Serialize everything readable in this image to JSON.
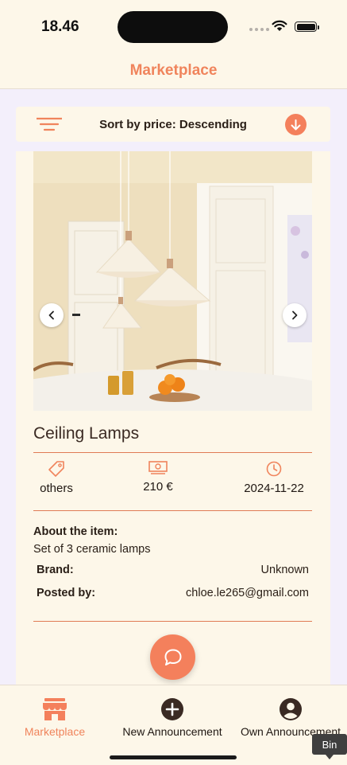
{
  "status_bar": {
    "time": "18.46"
  },
  "header": {
    "title": "Marketplace"
  },
  "sort": {
    "label": "Sort by price: Descending"
  },
  "item": {
    "title": "Ceiling Lamps",
    "category": "others",
    "price": "210 €",
    "date": "2024-11-22",
    "about_label": "About the item:",
    "description": "Set of 3 ceramic lamps",
    "brand_label": "Brand:",
    "brand_value": "Unknown",
    "posted_label": "Posted by:",
    "posted_value": "chloe.le265@gmail.com"
  },
  "tabs": [
    {
      "label": "Marketplace",
      "icon": "store-icon",
      "active": true
    },
    {
      "label": "New Announcement",
      "icon": "plus-circle-icon",
      "active": false
    },
    {
      "label": "Own Announcement",
      "icon": "account-circle-icon",
      "active": false
    }
  ],
  "tooltip": {
    "text": "Bin"
  },
  "colors": {
    "accent": "#f4805c",
    "background": "#fdf7e9",
    "text": "#3a2a23"
  }
}
